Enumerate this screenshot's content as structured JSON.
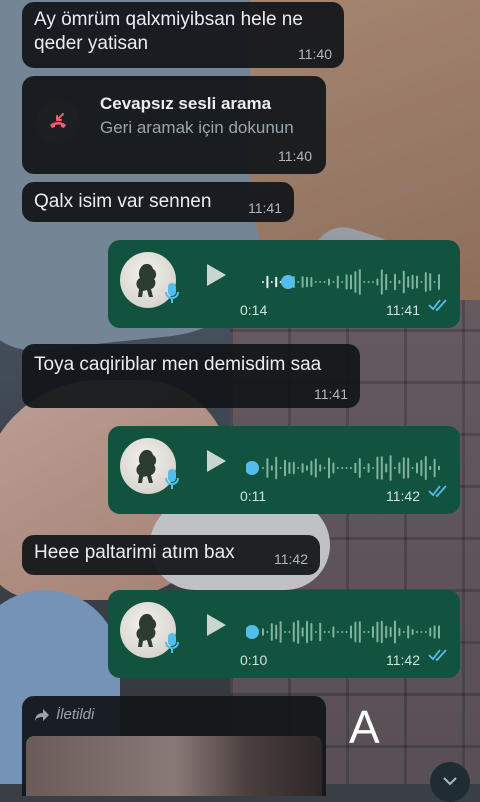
{
  "messages": [
    {
      "type": "text",
      "direction": "incoming",
      "text": "Ay ömrüm qalxmiyibsan hele ne qeder yatisan",
      "time": "11:40"
    },
    {
      "type": "missed_call",
      "title": "Cevapsız sesli arama",
      "subtitle": "Geri aramak için dokunun",
      "time": "11:40",
      "icon": "missed-call-icon",
      "accent": "#f15c6d"
    },
    {
      "type": "text",
      "direction": "incoming",
      "text": "Qalx isim var sennen",
      "time": "11:41"
    },
    {
      "type": "voice",
      "direction": "outgoing",
      "duration": "0:14",
      "time": "11:41",
      "progress": 0.2
    },
    {
      "type": "text",
      "direction": "incoming",
      "text": "Toya caqiriblar men demisdim saa",
      "time": "11:41"
    },
    {
      "type": "voice",
      "direction": "outgoing",
      "duration": "0:11",
      "time": "11:42",
      "progress": 0.0
    },
    {
      "type": "text",
      "direction": "incoming",
      "text": "Heee paltarimi atım bax",
      "time": "11:42"
    },
    {
      "type": "voice",
      "direction": "outgoing",
      "duration": "0:10",
      "time": "11:42",
      "progress": 0.0
    },
    {
      "type": "forwarded",
      "label": "İletildi",
      "icon": "forward-icon"
    }
  ],
  "colors": {
    "incoming_bubble": "#121619",
    "outgoing_bubble": "#12533f",
    "read_ticks": "#53bdeb",
    "mic_blue": "#53bdeb"
  },
  "overlay_letter": "A"
}
